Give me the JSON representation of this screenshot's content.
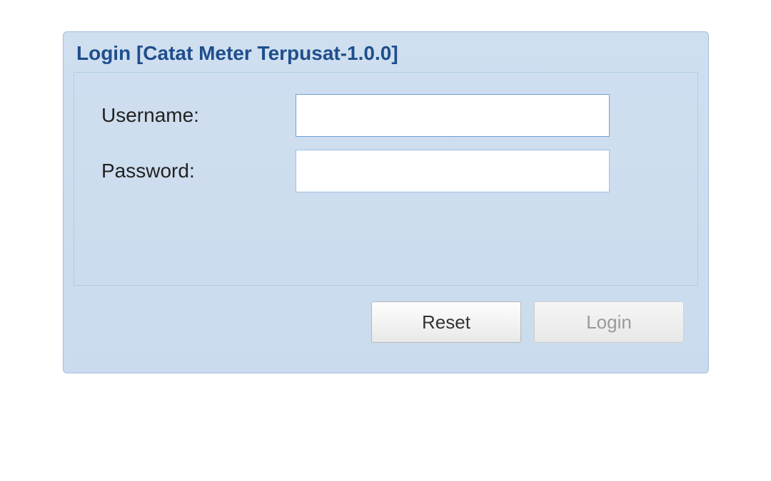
{
  "panel": {
    "title": "Login [Catat Meter Terpusat-1.0.0]"
  },
  "form": {
    "username_label": "Username:",
    "username_value": "",
    "password_label": "Password:",
    "password_value": ""
  },
  "buttons": {
    "reset_label": "Reset",
    "login_label": "Login"
  }
}
